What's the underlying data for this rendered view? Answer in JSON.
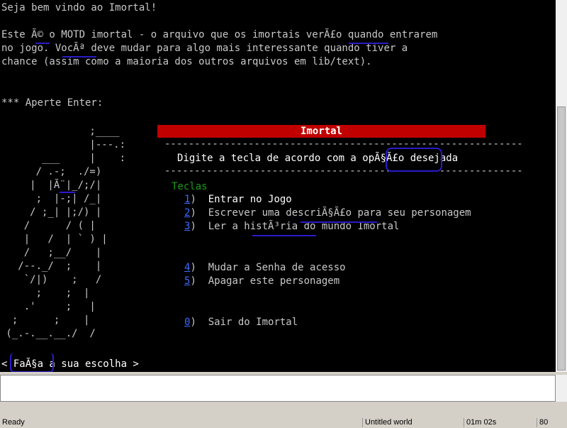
{
  "terminal": {
    "welcome": "Seja bem vindo ao Imortal!",
    "motd_line1": "Este Ã© o MOTD imortal - o arquivo que os imortais verÃ£o quando entrarem",
    "motd_line2": "no jogo. VocÃª deve mudar para algo mais interessante quando tiver a",
    "motd_line3": "chance (assim como a maioria dos outros arquivos em lib/text).",
    "press_enter": "*** Aperte Enter:",
    "ascii_art": [
      "               ;____",
      "               |---.:",
      "       ___     |    :",
      "      / .-;  ./=)",
      "     |  |Ã¨|_/;/|",
      "      ;  |-;| /_|",
      "     / ;_| |;/) |",
      "    /      / ( |",
      "    |   /  | ` ) |",
      "    /   ;__/    |",
      "   /--._/  ;    |",
      "    `/|)    ;   /",
      "      ;    ;  |",
      "    .'     ;   |",
      "  ;      ;    |",
      " (_.-.__.__./  /"
    ],
    "header_title": "Imortal",
    "dashes": "------------------------------------------------------------",
    "menu_prompt": "Digite a tecla de acordo com a opÃ§Ã£o desejada",
    "teclas_label": "Teclas",
    "menu_items": [
      {
        "key": "1",
        "label": "Entrar no Jogo"
      },
      {
        "key": "2",
        "label": "Escrever uma descriÃ§Ã£o para seu personagem"
      },
      {
        "key": "3",
        "label": "Ler a histÃ³ria do mundo Imortal"
      },
      {
        "key": "4",
        "label": "Mudar a Senha de acesso"
      },
      {
        "key": "5",
        "label": "Apagar este personagem"
      },
      {
        "key": "0",
        "label": "Sair do Imortal"
      }
    ],
    "choice_prompt": "< FaÃ§a a sua escolha >"
  },
  "input": {
    "value": ""
  },
  "status": {
    "ready": "Ready",
    "world": "Untitled world",
    "time": "01m 02s",
    "cols": "80"
  },
  "colors": {
    "accent_mark": "#2a1cc6",
    "header_bar": "#c00000",
    "link": "#3a6bff",
    "teclas": "#1a9a1a"
  }
}
